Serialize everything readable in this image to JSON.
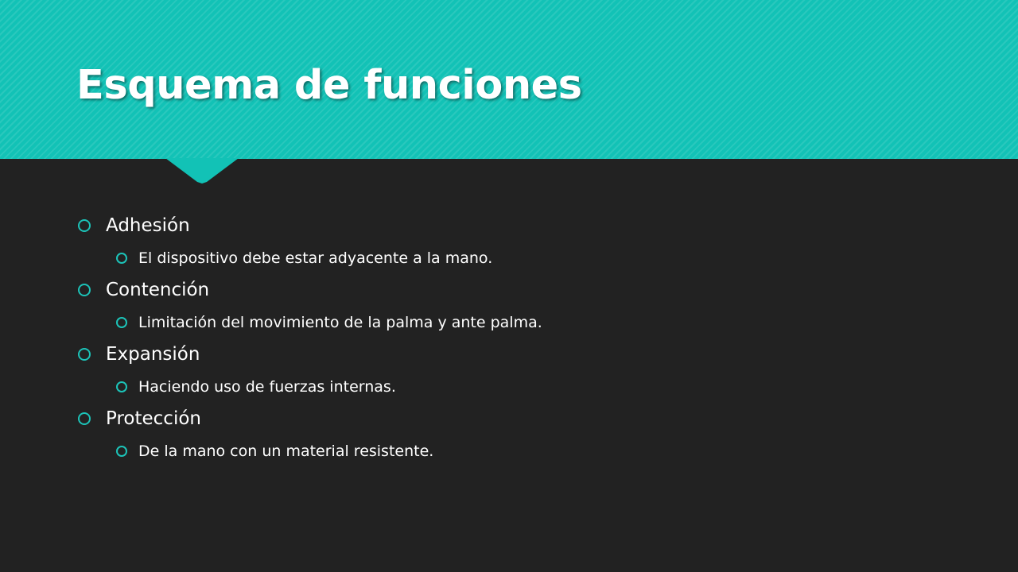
{
  "slide": {
    "title": "Esquema de funciones",
    "colors": {
      "accent": "#12c2b6",
      "background": "#222222",
      "text": "#ffffff"
    },
    "bullets": [
      {
        "text": "Adhesión",
        "sub": "El dispositivo debe estar adyacente a la mano."
      },
      {
        "text": "Contención",
        "sub": "Limitación del movimiento de la palma y ante palma."
      },
      {
        "text": "Expansión",
        "sub": "Haciendo uso de fuerzas internas."
      },
      {
        "text": "Protección",
        "sub": "De la mano con un material resistente."
      }
    ]
  }
}
